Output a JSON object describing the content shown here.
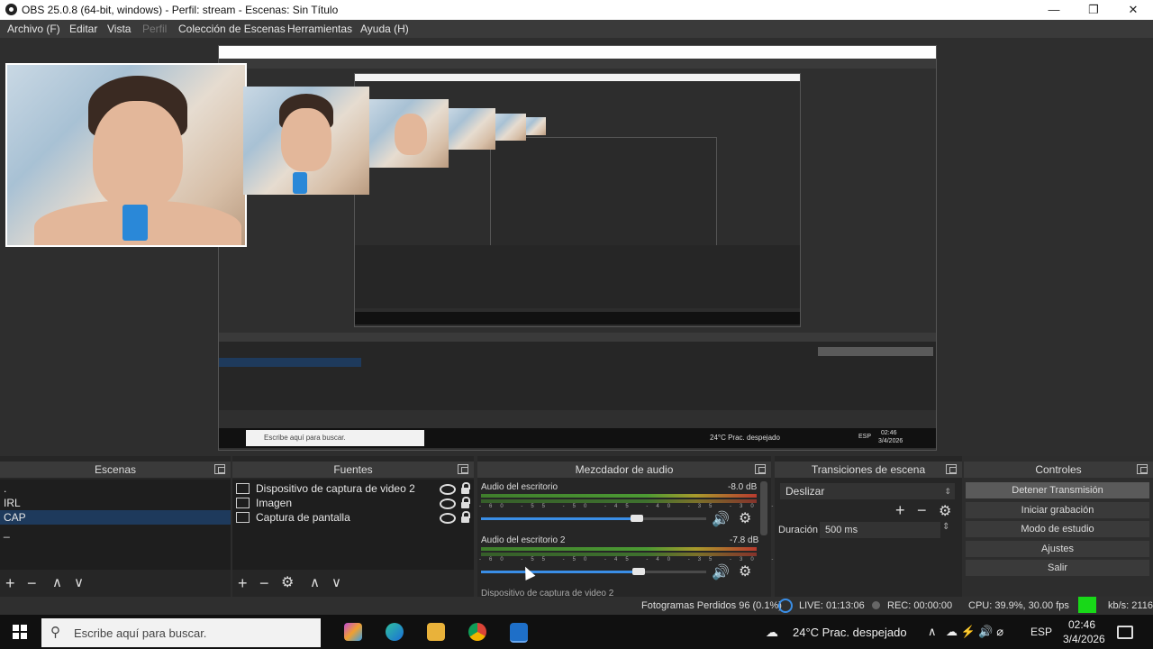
{
  "window": {
    "title": "OBS 25.0.8 (64-bit, windows) - Perfil: stream - Escenas: Sin Título"
  },
  "menu": [
    "Archivo (F)",
    "Editar",
    "Vista",
    "Perfil",
    "Colección de Escenas",
    "Herramientas",
    "Ayuda (H)"
  ],
  "scenes": {
    "title": "Escenas",
    "items": [
      ".",
      "IRL",
      "CAP",
      "_"
    ]
  },
  "sources": {
    "title": "Fuentes",
    "items": [
      "Dispositivo de captura de video 2",
      "Imagen",
      "Captura de pantalla"
    ]
  },
  "mixer": {
    "title": "Mezcdador de audio",
    "channels": [
      {
        "name": "Audio del escritorio",
        "db": "-8.0 dB",
        "volume": 0.69
      },
      {
        "name": "Audio del escritorio 2",
        "db": "-7.8 dB",
        "volume": 0.7
      }
    ],
    "third_partial": "Dispositivo de captura de video 2",
    "scale": "-60 -55 -50 -45 -40 -35 -30 -25 -20 -15 -10 -5 0"
  },
  "transitions": {
    "title": "Transiciones de escena",
    "selected": "Deslizar",
    "duration_label": "Duración",
    "duration_value": "500 ms"
  },
  "controls": {
    "title": "Controles",
    "buttons": [
      "Detener Transmisión",
      "Iniciar grabación",
      "Modo de estudio",
      "Ajustes",
      "Salir"
    ]
  },
  "status": {
    "dropped": "Fotogramas Perdidos 96 (0.1%)",
    "live": "LIVE: 01:13:06",
    "rec": "REC: 00:00:00",
    "cpu": "CPU: 39.9%, 30.00 fps",
    "kbs": "kb/s: 2116"
  },
  "taskbar": {
    "search_placeholder": "Escribe aquí para buscar.",
    "weather": "24°C  Prac. despejado",
    "lang": "ESP",
    "time": "02:46",
    "date": "3/4/2026"
  },
  "nested_taskbar": {
    "search": "Escribe aquí para buscar.",
    "weather": "24°C  Prac. despejado",
    "lang": "ESP",
    "time": "02:46",
    "date": "3/4/2026"
  }
}
